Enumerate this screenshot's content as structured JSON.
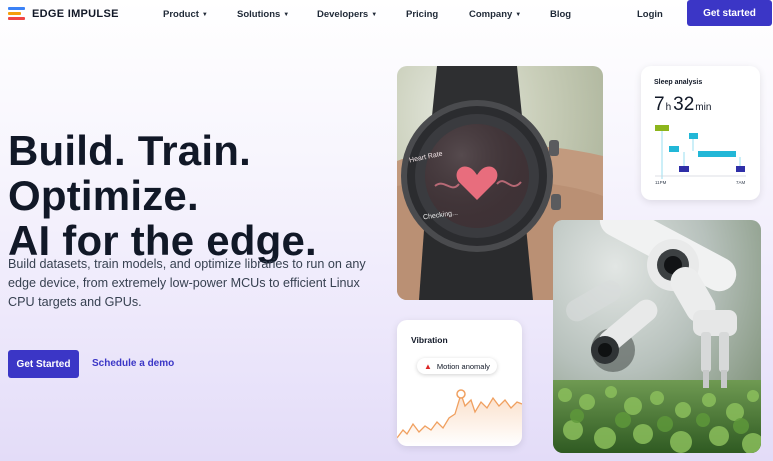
{
  "brand": {
    "name": "EDGE IMPULSE",
    "logo_colors": [
      "#ef4444",
      "#f59e0b",
      "#3b82f6"
    ]
  },
  "nav": {
    "items": [
      {
        "label": "Product",
        "has_dropdown": true
      },
      {
        "label": "Solutions",
        "has_dropdown": true
      },
      {
        "label": "Developers",
        "has_dropdown": true
      },
      {
        "label": "Pricing",
        "has_dropdown": false
      },
      {
        "label": "Company",
        "has_dropdown": true
      },
      {
        "label": "Blog",
        "has_dropdown": false
      }
    ],
    "login_label": "Login",
    "cta_label": "Get started"
  },
  "hero": {
    "headline": [
      "Build. Train.",
      "Optimize.",
      "AI for the edge."
    ],
    "description": "Build datasets, train models, and optimize libraries to run on any edge device, from extremely low-power MCUs to efficient Linux CPU targets and GPUs.",
    "primary_cta": "Get Started",
    "secondary_cta": "Schedule a demo"
  },
  "watch_card": {
    "heart_label": "Heart Rate",
    "status": "Checking..."
  },
  "sleep_card": {
    "title": "Sleep analysis",
    "hours": "7",
    "hours_unit": "h",
    "minutes": "32",
    "minutes_unit": "min",
    "start_label": "11PM",
    "end_label": "7AM"
  },
  "vibration_card": {
    "title": "Vibration",
    "alert": "Motion anomaly"
  },
  "colors": {
    "accent": "#3b36c6",
    "vibration_line": "#f0a060",
    "sleep_green": "#8cb51c",
    "sleep_cyan": "#22b7d7",
    "sleep_navy": "#2f2fa8"
  }
}
